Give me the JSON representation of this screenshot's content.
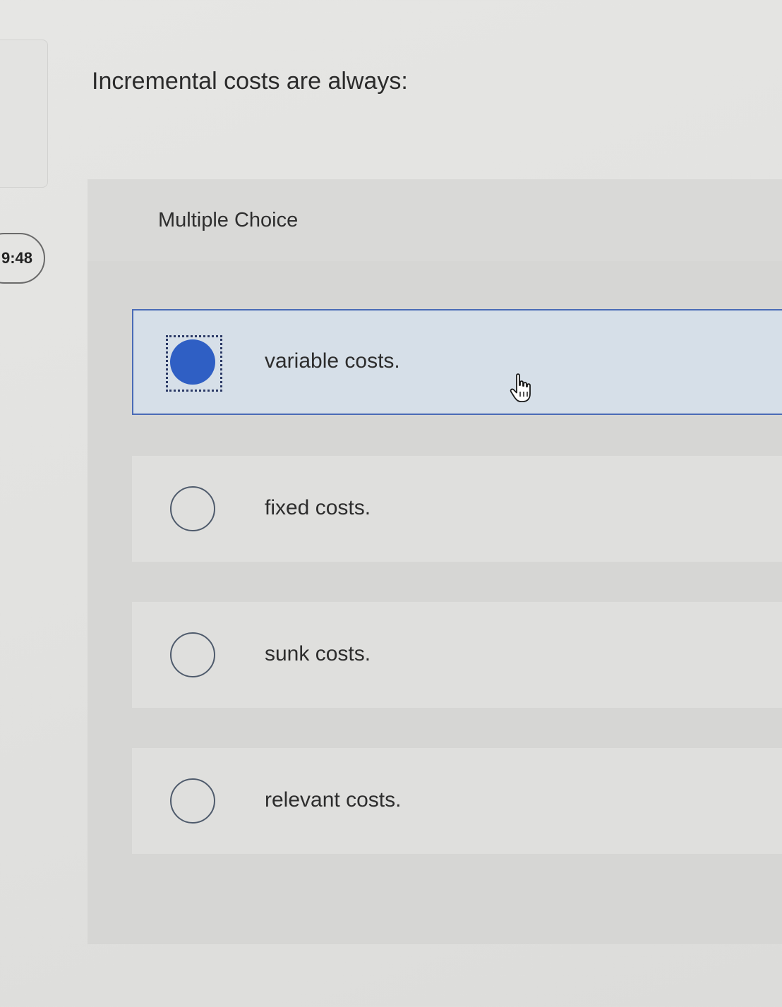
{
  "timer": {
    "text": "9:48"
  },
  "question": {
    "text": "Incremental costs are always:"
  },
  "answer_panel": {
    "header": "Multiple Choice",
    "options": [
      {
        "label": "variable costs.",
        "selected": true
      },
      {
        "label": "fixed costs.",
        "selected": false
      },
      {
        "label": "sunk costs.",
        "selected": false
      },
      {
        "label": "relevant costs.",
        "selected": false
      }
    ]
  },
  "icons": {
    "cursor": "hand-pointer-icon"
  },
  "colors": {
    "selected_fill": "#2f5fc4",
    "selected_border": "#4a6bb6",
    "selected_background": "#d6dfe8"
  }
}
